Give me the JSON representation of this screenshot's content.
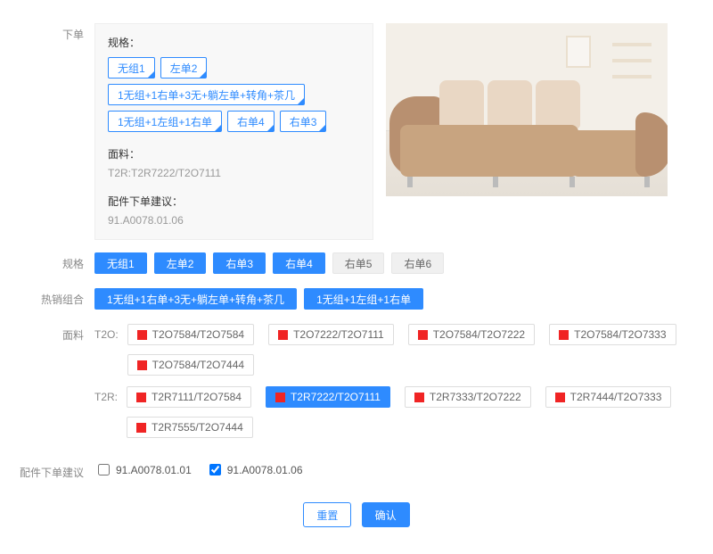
{
  "order": {
    "section_label": "下单",
    "summary": {
      "spec_title": "规格：",
      "spec_tags": [
        "无组1",
        "左单2",
        "1无组+1右单+3无+躺左单+转角+茶几",
        "1无组+1左组+1右单",
        "右单4",
        "右单3"
      ],
      "fabric_title": "面料：",
      "fabric_value": "T2R:T2R7222/T2O7111",
      "suggest_title": "配件下单建议：",
      "suggest_value": "91.A0078.01.06"
    }
  },
  "spec": {
    "label": "规格",
    "options": [
      {
        "text": "无组1",
        "selected": true
      },
      {
        "text": "左单2",
        "selected": true
      },
      {
        "text": "右单3",
        "selected": true
      },
      {
        "text": "右单4",
        "selected": true
      },
      {
        "text": "右单5",
        "selected": false
      },
      {
        "text": "右单6",
        "selected": false
      }
    ]
  },
  "combo": {
    "label": "热销组合",
    "options": [
      {
        "text": "1无组+1右单+3无+躺左单+转角+茶几",
        "selected": true
      },
      {
        "text": "1无组+1左组+1右单",
        "selected": true
      }
    ]
  },
  "fabric": {
    "label": "面料",
    "groups": [
      {
        "lead": "T2O:",
        "options": [
          {
            "text": "T2O7584/T2O7584",
            "selected": false,
            "swatch": "#f02424"
          },
          {
            "text": "T2O7222/T2O7111",
            "selected": false,
            "swatch": "#f02424"
          },
          {
            "text": "T2O7584/T2O7222",
            "selected": false,
            "swatch": "#f02424"
          },
          {
            "text": "T2O7584/T2O7333",
            "selected": false,
            "swatch": "#f02424"
          },
          {
            "text": "T2O7584/T2O7444",
            "selected": false,
            "swatch": "#f02424"
          }
        ]
      },
      {
        "lead": "T2R:",
        "options": [
          {
            "text": "T2R7111/T2O7584",
            "selected": false,
            "swatch": "#f02424"
          },
          {
            "text": "T2R7222/T2O7111",
            "selected": true,
            "swatch": "#f02424"
          },
          {
            "text": "T2R7333/T2O7222",
            "selected": false,
            "swatch": "#f02424"
          },
          {
            "text": "T2R7444/T2O7333",
            "selected": false,
            "swatch": "#f02424"
          },
          {
            "text": "T2R7555/T2O7444",
            "selected": false,
            "swatch": "#f02424"
          }
        ]
      }
    ]
  },
  "accessory": {
    "label": "配件下单建议",
    "options": [
      {
        "text": "91.A0078.01.01",
        "checked": false
      },
      {
        "text": "91.A0078.01.06",
        "checked": true
      }
    ]
  },
  "footer": {
    "reset": "重置",
    "confirm": "确认"
  }
}
